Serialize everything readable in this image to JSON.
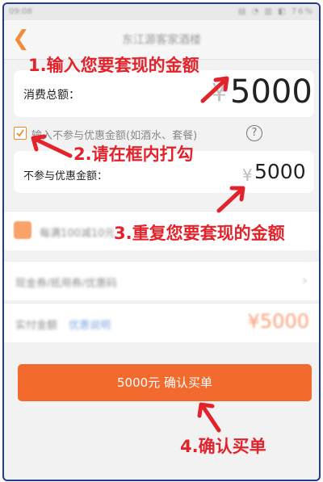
{
  "status_bar": {
    "time": "09:08",
    "icons": "▤ ◔ ▥ ◧ 76%"
  },
  "header": {
    "title": "东江源客家酒楼"
  },
  "total": {
    "label": "消费总额：",
    "currency": "¥",
    "amount": "5000"
  },
  "exclude_option": {
    "label": "输入不参与优惠金额(如酒水、套餐)",
    "help": "?"
  },
  "exclude": {
    "label": "不参与优惠金额：",
    "currency": "¥",
    "amount": "5000"
  },
  "promo": {
    "text": "每满100减10元"
  },
  "coupon": {
    "text": "现金券/抵用券/优惠码",
    "chevron": "›"
  },
  "pay": {
    "label": "实付金额",
    "note": "优惠说明",
    "amount": "¥5000"
  },
  "confirm_button": {
    "label": "5000元 确认买单"
  },
  "annotations": {
    "step1": "1.输入您要套现的金额",
    "step2": "2.请在框内打勾",
    "step3": "3.重复您要套现的金额",
    "step4": "4.确认买单"
  },
  "colors": {
    "accent": "#f26a2e",
    "annotation": "#e3232b",
    "frame": "#1d3d8f"
  }
}
